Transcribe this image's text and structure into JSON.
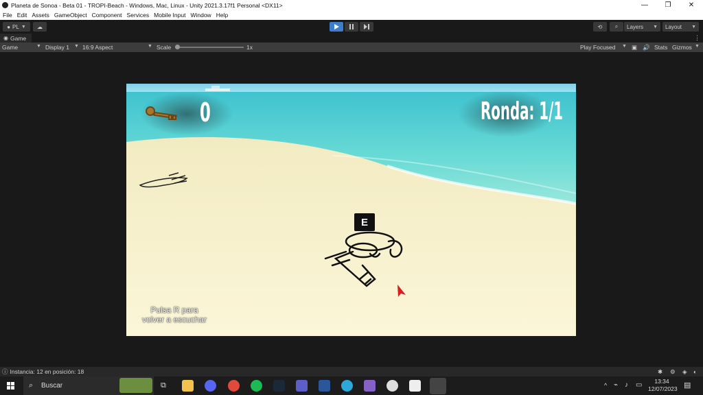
{
  "window": {
    "title": "Planeta de Sonoa - Beta 01 - TROPI-Beach - Windows, Mac, Linux - Unity 2021.3.17f1 Personal <DX11>",
    "minimize": "—",
    "maximize": "❐",
    "close": "✕"
  },
  "menu": [
    "File",
    "Edit",
    "Assets",
    "GameObject",
    "Component",
    "Services",
    "Mobile Input",
    "Window",
    "Help"
  ],
  "toolbar": {
    "account": "PL",
    "layers": "Layers",
    "layout": "Layout"
  },
  "tab": {
    "label": "Game"
  },
  "gamebar": {
    "mode": "Game",
    "display": "Display 1",
    "aspect": "16:9 Aspect",
    "scale_label": "Scale",
    "scale_value": "1x",
    "play_focused": "Play Focused",
    "stats": "Stats",
    "gizmos": "Gizmos"
  },
  "game": {
    "key_count": "0",
    "round": "Ronda: 1/1",
    "interact_key": "E",
    "hint_line1": "Pulsa R para",
    "hint_line2": "volver a escuchar"
  },
  "status": {
    "message": "Instancia: 12 en posición: 18"
  },
  "taskbar": {
    "search_placeholder": "Buscar",
    "time": "13:34",
    "date": "12/07/2023"
  },
  "colors": {
    "play_blue": "#3c7ecb",
    "sea": "#5fd6cf",
    "sand": "#f6efc7"
  }
}
